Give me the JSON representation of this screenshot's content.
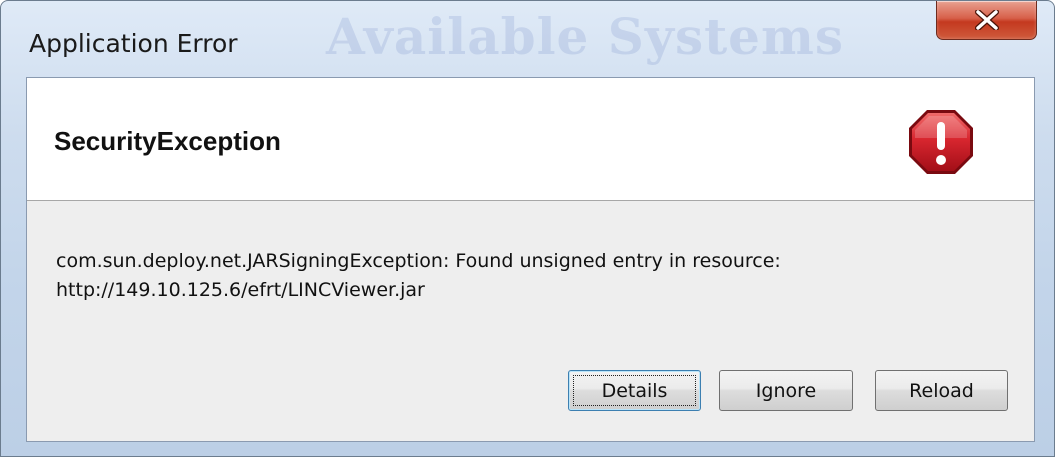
{
  "window": {
    "title": "Application Error",
    "watermark": "Available Systems",
    "close_glyph": "X"
  },
  "header": {
    "title": "SecurityException",
    "icon": "stop-error-icon"
  },
  "message": {
    "line1": "com.sun.deploy.net.JARSigningException: Found unsigned entry in resource:",
    "line2": "http://149.10.125.6/efrt/LINCViewer.jar"
  },
  "buttons": {
    "details": "Details",
    "ignore": "Ignore",
    "reload": "Reload"
  },
  "colors": {
    "stop_icon": "#d8262f",
    "close_button": "#c4391f"
  }
}
